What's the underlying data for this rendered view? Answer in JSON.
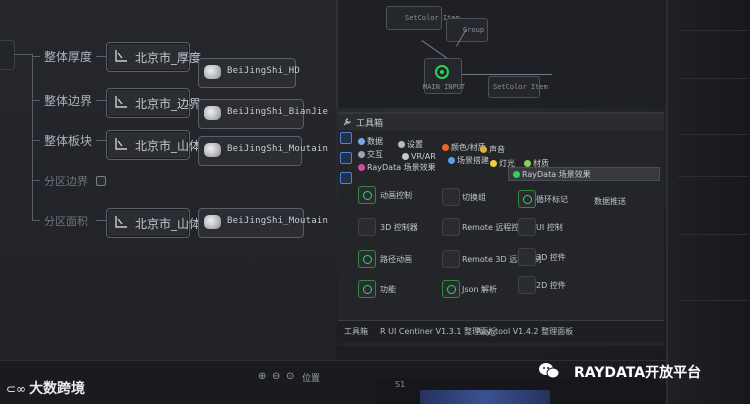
{
  "editor": {
    "groups": [
      {
        "label": "整体厚度",
        "node": "北京市_厚度",
        "asset": "BeiJingShi_HD"
      },
      {
        "label": "整体边界",
        "node": "北京市_边界",
        "asset": "BeiJingShi_BianJie"
      },
      {
        "label": "整体板块",
        "node": "北京市_山体",
        "asset": "BeiJingShi_Moutain"
      },
      {
        "label": "分区边界"
      },
      {
        "label": "分区面积",
        "node": "北京市_山体",
        "asset": "BeiJingShi_Moutain"
      }
    ]
  },
  "graph": {
    "node1": "SetColor Item",
    "node2": "Group",
    "node3": "MAIN INPUT",
    "node4": "SetColor Item"
  },
  "toolbox": {
    "title": "工具箱",
    "categories": {
      "data": "数据",
      "settings": "设置",
      "color": "颜色/材质",
      "sound": "声音",
      "interact": "交互",
      "vr": "VR/AR",
      "scene": "场景搭建",
      "light": "灯光",
      "material": "材质",
      "raydata": "RayData 场景效果",
      "raydata2": "RayData 场景效果"
    },
    "tools": [
      {
        "label": "动画控制"
      },
      {
        "label": "切换组"
      },
      {
        "label": "循环标记"
      },
      {
        "label": "3D 控制器"
      },
      {
        "label": "Remote 远程控制"
      },
      {
        "label": "UI 控制"
      },
      {
        "label": "路径动画"
      },
      {
        "label": "Remote 3D 远程控制"
      },
      {
        "label": "3D 控件"
      },
      {
        "label": "功能"
      },
      {
        "label": "Json 解析"
      },
      {
        "label": "2D 控件"
      },
      {
        "label": "数据推送"
      }
    ],
    "status": [
      "工具箱",
      "R UI Centiner V1.3.1 整理面板",
      "Ray_tool V1.4.2 整理面板"
    ]
  },
  "bottom": {
    "zoom": "位置",
    "marker": "S1"
  },
  "watermark": {
    "left": "大数跨境",
    "right": "RAYDATA开放平台"
  },
  "colors": {
    "accent_green": "#2ed15a",
    "accent_blue": "#4f7fd0",
    "accent_orange": "#e46a2a"
  }
}
